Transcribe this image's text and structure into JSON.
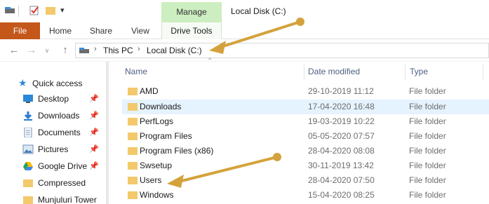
{
  "title_bar": {
    "manage_label": "Manage",
    "window_title": "Local Disk (C:)",
    "qat_icons": [
      "properties-icon",
      "new-folder-icon",
      "customize-qat-icon"
    ]
  },
  "ribbon": {
    "file_tab": "File",
    "tabs": [
      "Home",
      "Share",
      "View"
    ],
    "contextual_tab": "Drive Tools"
  },
  "address_bar": {
    "breadcrumbs": [
      "This PC",
      "Local Disk (C:)"
    ]
  },
  "nav_pane": {
    "quick_access_label": "Quick access",
    "items": [
      {
        "label": "Desktop",
        "icon": "desktop-icon",
        "pinned": true
      },
      {
        "label": "Downloads",
        "icon": "downloads-icon",
        "pinned": true
      },
      {
        "label": "Documents",
        "icon": "documents-icon",
        "pinned": true
      },
      {
        "label": "Pictures",
        "icon": "pictures-icon",
        "pinned": true
      },
      {
        "label": "Google Drive",
        "icon": "google-drive-icon",
        "pinned": true
      },
      {
        "label": "Compressed",
        "icon": "folder-icon",
        "pinned": false
      },
      {
        "label": "Munjuluri Tower",
        "icon": "folder-icon",
        "pinned": false
      }
    ]
  },
  "file_list": {
    "columns": [
      "Name",
      "Date modified",
      "Type"
    ],
    "rows": [
      {
        "name": "AMD",
        "date": "29-10-2019 11:12",
        "type": "File folder"
      },
      {
        "name": "Downloads",
        "date": "17-04-2020 16:48",
        "type": "File folder",
        "selected": true
      },
      {
        "name": "PerfLogs",
        "date": "19-03-2019 10:22",
        "type": "File folder"
      },
      {
        "name": "Program Files",
        "date": "05-05-2020 07:57",
        "type": "File folder"
      },
      {
        "name": "Program Files (x86)",
        "date": "28-04-2020 08:08",
        "type": "File folder"
      },
      {
        "name": "Swsetup",
        "date": "30-11-2019 13:42",
        "type": "File folder"
      },
      {
        "name": "Users",
        "date": "28-04-2020 07:50",
        "type": "File folder"
      },
      {
        "name": "Windows",
        "date": "15-04-2020 08:25",
        "type": "File folder"
      }
    ]
  },
  "colors": {
    "file_tab": "#c4571a",
    "manage_tab": "#cdeec0",
    "selection": "#e5f3ff",
    "folder": "#f3c96b",
    "annotation_arrow": "#d4a23c"
  }
}
